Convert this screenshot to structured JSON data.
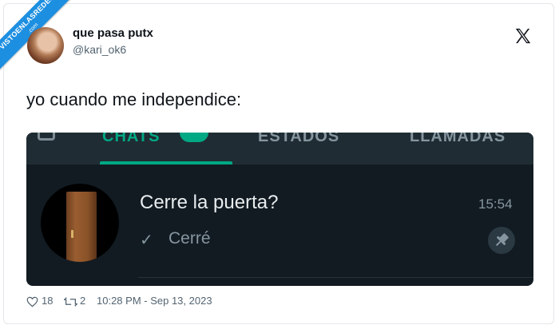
{
  "watermark": {
    "line1": "VISTOENLASREDES",
    "line2": ".com"
  },
  "author": {
    "display_name": "que pasa putx",
    "handle": "@kari_ok6"
  },
  "header": {
    "logo_icon": "x-logo-icon"
  },
  "tweet": {
    "text": "yo cuando me independice:"
  },
  "screenshot": {
    "tabs": [
      {
        "label": "CHATS"
      },
      {
        "label": "ESTADOS"
      },
      {
        "label": "LLAMADAS"
      }
    ],
    "chat": {
      "title": "Cerre la puerta?",
      "time": "15:54",
      "check": "✓",
      "preview": "Cerré",
      "pin_icon": "pin-icon"
    }
  },
  "footer": {
    "likes": "18",
    "retweets": "2",
    "timestamp": "10:28 PM - Sep 13, 2023"
  },
  "colors": {
    "accent": "#00a884",
    "ribbon": "#1d8fe1",
    "app_background": "#121b22"
  }
}
